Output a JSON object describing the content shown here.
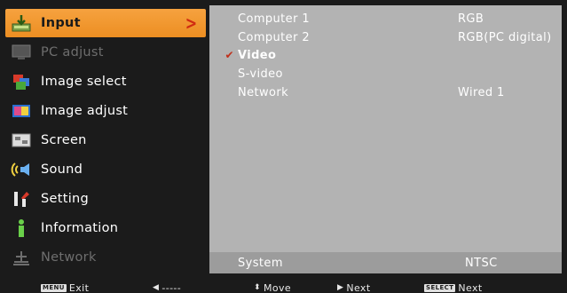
{
  "menu": {
    "items": [
      {
        "label": "Input",
        "icon": "input-icon",
        "state": "selected"
      },
      {
        "label": "PC adjust",
        "icon": "pc-adjust-icon",
        "state": "disabled"
      },
      {
        "label": "Image select",
        "icon": "image-select-icon",
        "state": "normal"
      },
      {
        "label": "Image adjust",
        "icon": "image-adjust-icon",
        "state": "normal"
      },
      {
        "label": "Screen",
        "icon": "screen-icon",
        "state": "normal"
      },
      {
        "label": "Sound",
        "icon": "sound-icon",
        "state": "normal"
      },
      {
        "label": "Setting",
        "icon": "setting-icon",
        "state": "normal"
      },
      {
        "label": "Information",
        "icon": "information-icon",
        "state": "normal"
      },
      {
        "label": "Network",
        "icon": "network-icon",
        "state": "disabled"
      }
    ],
    "selected_arrow": ">"
  },
  "panel": {
    "rows": [
      {
        "name": "Computer 1",
        "value": "RGB",
        "checked": false
      },
      {
        "name": "Computer 2",
        "value": "RGB(PC digital)",
        "checked": false
      },
      {
        "name": "Video",
        "value": "",
        "checked": true
      },
      {
        "name": "S-video",
        "value": "",
        "checked": false
      },
      {
        "name": "Network",
        "value": "Wired 1",
        "checked": false
      }
    ],
    "check_glyph": "✔",
    "system": {
      "name": "System",
      "value": "NTSC"
    }
  },
  "bottombar": {
    "exit_key": "MENU",
    "exit_label": "Exit",
    "back_glyph": "◀",
    "back_label": "-----",
    "move_glyph": "⬍",
    "move_label": "Move",
    "next_glyph": "▶",
    "next_label": "Next",
    "select_key": "SELECT",
    "select_label": "Next"
  },
  "colors": {
    "accent": "#f39a34",
    "panel": "#b3b3b3",
    "background": "#1b1b1b",
    "check": "#c0301a"
  }
}
